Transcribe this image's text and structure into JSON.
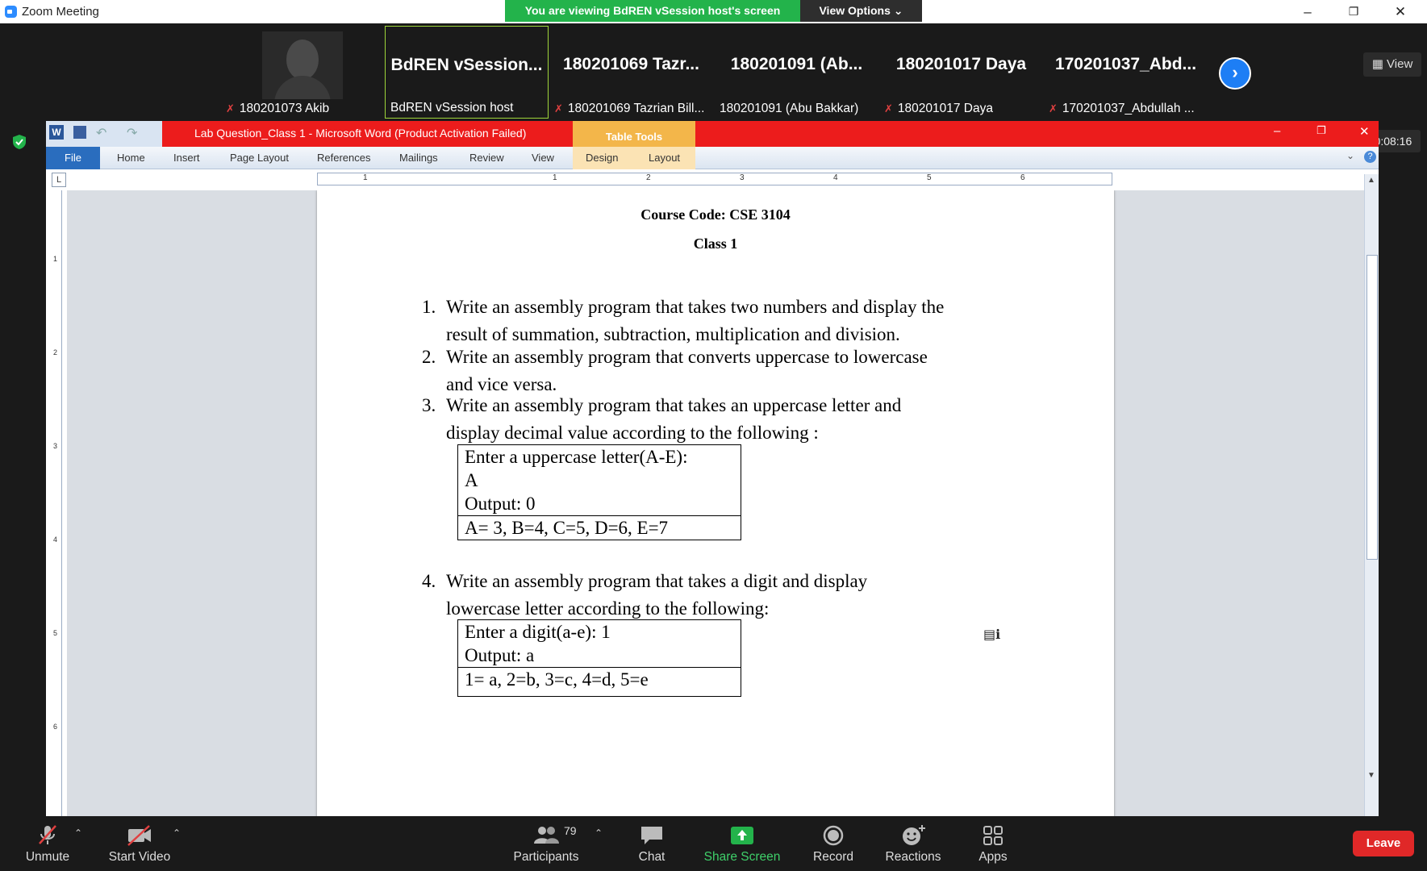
{
  "app": {
    "title": "Zoom Meeting"
  },
  "banner": {
    "sharing": "You are viewing BdREN vSession host's screen",
    "view_options": "View Options ⌄"
  },
  "participants_strip": [
    {
      "big": "",
      "name": "180201073 Akib",
      "muted": true,
      "has_video": true
    },
    {
      "big": "BdREN  vSession...",
      "name": "BdREN vSession host",
      "muted": false,
      "active": true
    },
    {
      "big": "180201069  Tazr...",
      "name": "180201069 Tazrian Bill...",
      "muted": true
    },
    {
      "big": "180201091  (Ab...",
      "name": "180201091 (Abu Bakkar)",
      "muted": false
    },
    {
      "big": "180201017 Daya",
      "name": "180201017 Daya",
      "muted": true
    },
    {
      "big": "170201037_Abd...",
      "name": "170201037_Abdullah ...",
      "muted": true
    }
  ],
  "view_button": "View",
  "timer": "00:08:16",
  "word": {
    "title": "Lab Question_Class 1  -  Microsoft Word (Product Activation Failed)",
    "context_tab": "Table Tools",
    "tabs": [
      "File",
      "Home",
      "Insert",
      "Page Layout",
      "References",
      "Mailings",
      "Review",
      "View",
      "Design",
      "Layout"
    ],
    "ruler_numbers": [
      "1",
      "1",
      "2",
      "3",
      "4",
      "5",
      "6"
    ],
    "vruler_numbers": [
      "1",
      "2",
      "3",
      "4",
      "5",
      "6"
    ]
  },
  "doc": {
    "course_code": "Course Code: CSE 3104",
    "class": "Class 1",
    "q1": {
      "num": "1.",
      "line1": "Write an assembly program that takes two numbers and display the",
      "line2": "result of summation, subtraction, multiplication and division."
    },
    "q2": {
      "num": "2.",
      "line1": "Write an assembly program that converts uppercase to lowercase",
      "line2": "and vice versa."
    },
    "q3": {
      "num": "3.",
      "line1": "Write an assembly program  that takes an uppercase letter and",
      "line2": "display decimal value according to the following :"
    },
    "box1": {
      "l1": "Enter a uppercase letter(A-E):",
      "l2": "A",
      "l3": "Output: 0",
      "l4": "A= 3, B=4, C=5, D=6, E=7"
    },
    "q4": {
      "num": "4.",
      "line1": "Write an assembly program  that takes a digit and  display",
      "line2": "lowercase letter according to the following:"
    },
    "box2": {
      "l1": "Enter a digit(a-e):  1",
      "l2": "Output: a",
      "l3": "1= a, 2=b, 3=c, 4=d, 5=e"
    }
  },
  "toolbar": {
    "unmute": "Unmute",
    "start_video": "Start Video",
    "participants": "Participants",
    "participants_count": "79",
    "chat": "Chat",
    "share_screen": "Share Screen",
    "record": "Record",
    "reactions": "Reactions",
    "apps": "Apps",
    "leave": "Leave"
  },
  "colors": {
    "share_green": "#23b34b",
    "word_red": "#ec1c1c",
    "leave_red": "#e02828",
    "accent_blue": "#1d7ef5"
  }
}
